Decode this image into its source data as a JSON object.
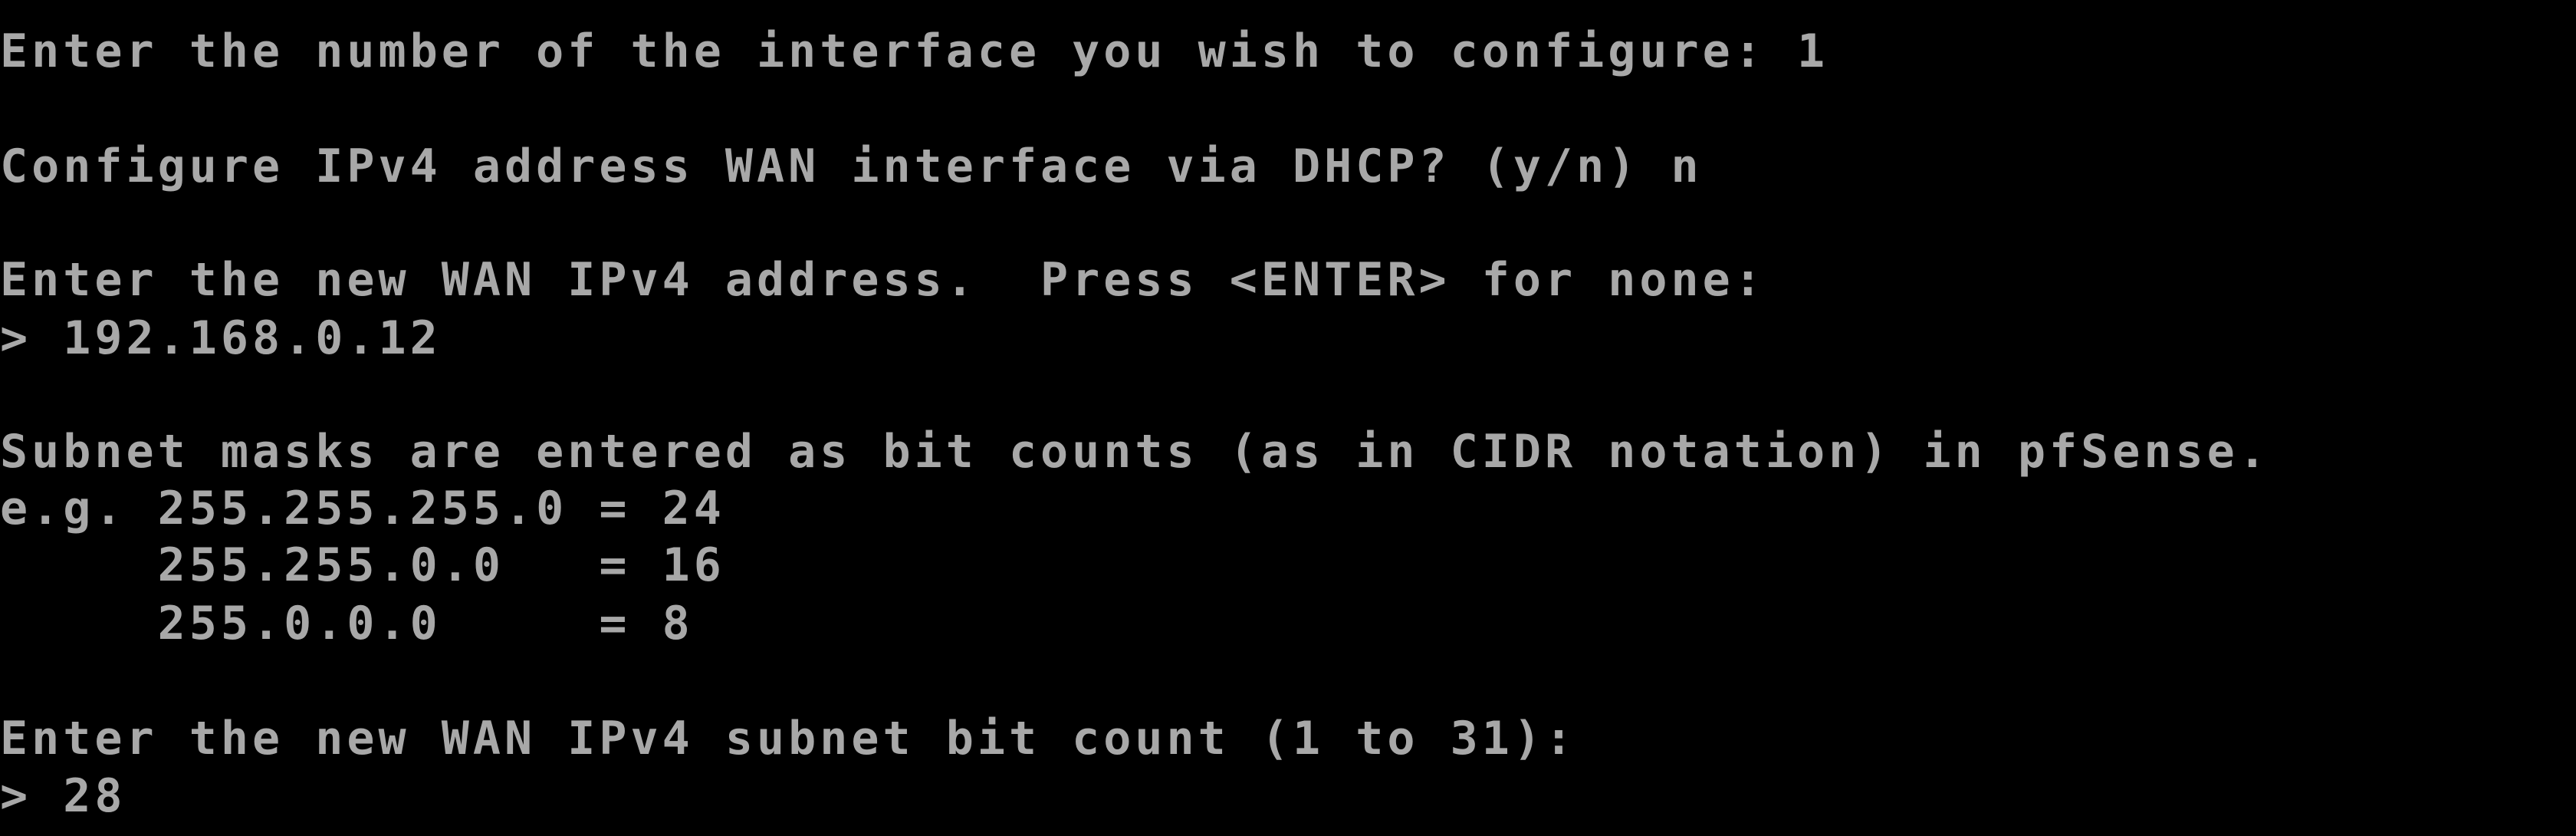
{
  "terminal": {
    "background_color": "#000000",
    "text_color": "#a8a8a8",
    "lines": [
      "Enter the number of the interface you wish to configure: 1",
      "Configure IPv4 address WAN interface via DHCP? (y/n) n",
      "Enter the new WAN IPv4 address.  Press <ENTER> for none:",
      "> 192.168.0.12",
      "Subnet masks are entered as bit counts (as in CIDR notation) in pfSense.",
      "e.g. 255.255.255.0 = 24",
      "     255.255.0.0   = 16",
      "     255.0.0.0     = 8",
      "Enter the new WAN IPv4 subnet bit count (1 to 31):",
      "> 28"
    ]
  }
}
